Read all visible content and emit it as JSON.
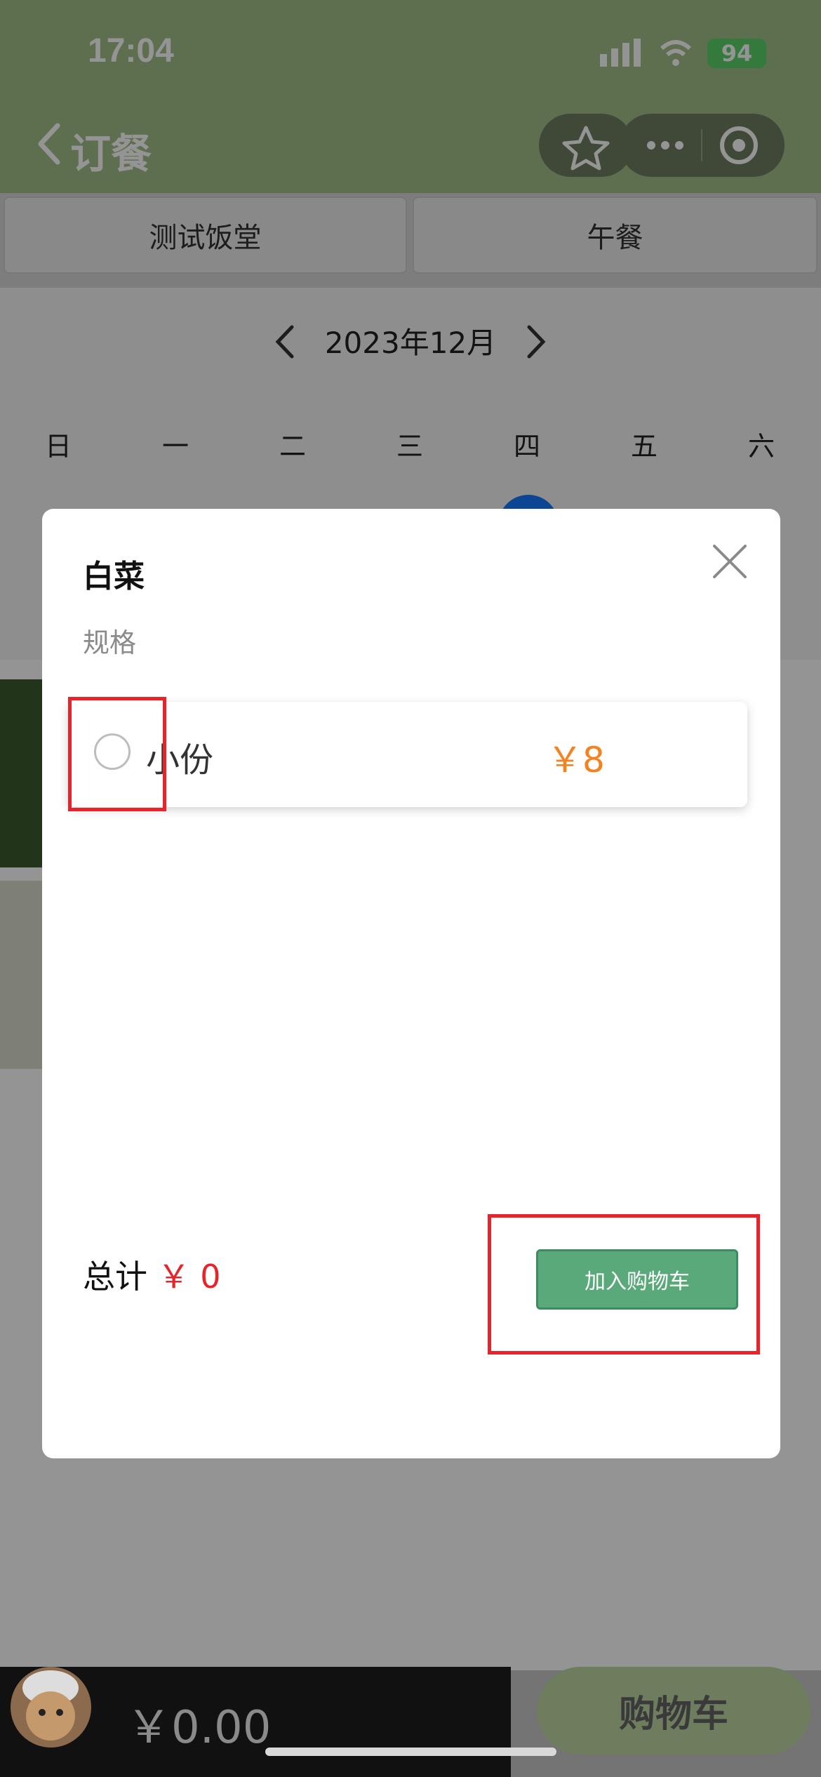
{
  "status_bar": {
    "time": "17:04",
    "battery": "94"
  },
  "nav": {
    "title": "订餐"
  },
  "tabs": [
    "测试饭堂",
    "午餐"
  ],
  "calendar": {
    "month_label": "2023年12月",
    "weekdays": [
      "日",
      "一",
      "二",
      "三",
      "四",
      "五",
      "六"
    ]
  },
  "modal": {
    "dish_name": "白菜",
    "spec_label": "规格",
    "option": {
      "label": "小份",
      "price": "￥8"
    },
    "total_label": "总计",
    "total_value": "￥ 0",
    "add_to_cart_label": "加入购物车"
  },
  "bottom_bar": {
    "amount": "￥0.00",
    "cart_label": "购物车"
  },
  "colors": {
    "accent_green": "#5aa97a",
    "price_orange": "#f58220",
    "highlight_red": "#e8232a"
  }
}
